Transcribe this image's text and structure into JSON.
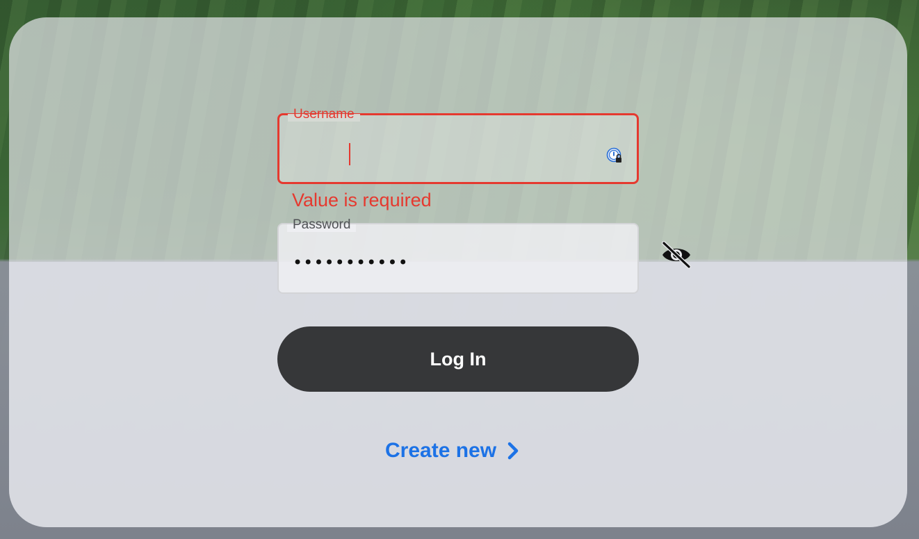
{
  "username": {
    "label": "Username",
    "value": "",
    "error": "Value is required"
  },
  "password": {
    "label": "Password",
    "value_masked": "•••••••••••"
  },
  "actions": {
    "login_label": "Log In",
    "create_label": "Create new"
  },
  "colors": {
    "error": "#e5392f",
    "button": "#363739",
    "link": "#1c72e6"
  },
  "icons": [
    "password-manager-icon",
    "eye-off-icon",
    "chevron-right-icon"
  ]
}
